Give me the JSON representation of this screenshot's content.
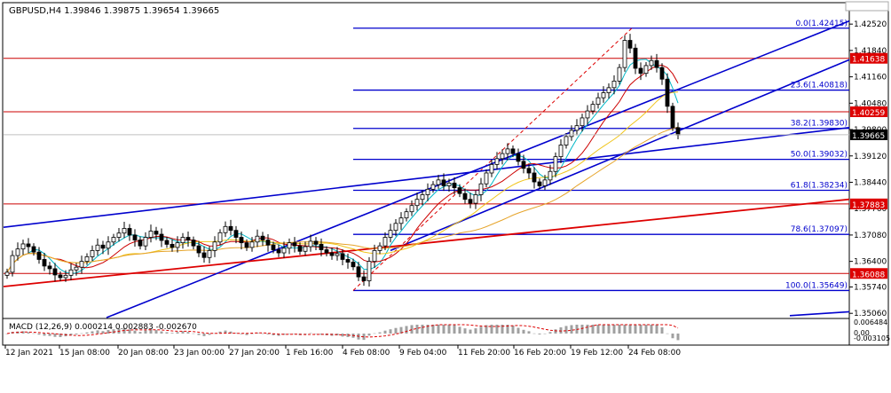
{
  "header": {
    "title": "GBPUSD,H4  1.39846 1.39875 1.39654 1.39665"
  },
  "macd_header": {
    "text": "MACD (12,26,9) 0.000214 0.002883 -0.002670"
  },
  "colors": {
    "background": "#ffffff",
    "candle": "#000000",
    "fib_line": "#0000cd",
    "fib_label": "#0000cd",
    "horizontal_level": "#cc0000",
    "trendline_blue": "#0000cd",
    "trendline_red": "#dd0000",
    "ma_fast": "#00b7c7",
    "ma_mid": "#cc0000",
    "ma_slow": "#f0c419",
    "ma_slowest": "#e6a42a",
    "fib_diagonal": "#dd0000",
    "price_tag_bg": "#dd0000",
    "current_tag_bg": "#000000",
    "tag_text": "#ffffff",
    "grid_text": "#000000",
    "macd_hist": "#a0a0a0",
    "macd_signal": "#dd0000"
  },
  "chart_data": {
    "type": "candlestick",
    "symbol": "GBPUSD",
    "timeframe": "H4",
    "ohlc_last": {
      "open": 1.39846,
      "high": 1.39875,
      "low": 1.39654,
      "close": 1.39665
    },
    "ylim": [
      1.3495,
      1.4305
    ],
    "y_ticks": [
      "1.42520",
      "1.41840",
      "1.41160",
      "1.40480",
      "1.39800",
      "1.39120",
      "1.38440",
      "1.37760",
      "1.37080",
      "1.36400",
      "1.35740",
      "1.35060"
    ],
    "x_labels": [
      "12 Jan 2021",
      "15 Jan 08:00",
      "20 Jan 08:00",
      "23 Jan 00:00",
      "27 Jan 20:00",
      "1 Feb 16:00",
      "4 Feb 08:00",
      "9 Feb 04:00",
      "11 Feb 20:00",
      "16 Feb 20:00",
      "19 Feb 12:00",
      "24 Feb 08:00"
    ],
    "fibonacci": [
      {
        "label": "0.0(1.42415)",
        "value": 1.42415
      },
      {
        "label": "23.6(1.40818)",
        "value": 1.40818
      },
      {
        "label": "38.2(1.39830)",
        "value": 1.3983
      },
      {
        "label": "50.0(1.39032)",
        "value": 1.39032
      },
      {
        "label": "61.8(1.38234)",
        "value": 1.38234
      },
      {
        "label": "78.6(1.37097)",
        "value": 1.37097
      },
      {
        "label": "100.0(1.35649)",
        "value": 1.35649
      }
    ],
    "horizontal_levels": [
      {
        "label": "1.41638",
        "value": 1.41638
      },
      {
        "label": "1.40259",
        "value": 1.40259
      },
      {
        "label": "1.37883",
        "value": 1.37883
      },
      {
        "label": "1.36088",
        "value": 1.36088
      }
    ],
    "current_price": {
      "label": "1.39665",
      "value": 1.39665
    },
    "close_series": [
      1.3612,
      1.3655,
      1.3672,
      1.3685,
      1.3678,
      1.3664,
      1.3645,
      1.3628,
      1.3621,
      1.3605,
      1.3598,
      1.3604,
      1.3618,
      1.3625,
      1.364,
      1.3652,
      1.3668,
      1.3682,
      1.3674,
      1.369,
      1.3702,
      1.3713,
      1.3725,
      1.3708,
      1.3695,
      1.368,
      1.3702,
      1.3718,
      1.371,
      1.3694,
      1.3684,
      1.3676,
      1.3688,
      1.3702,
      1.3695,
      1.368,
      1.3662,
      1.365,
      1.3668,
      1.369,
      1.3714,
      1.373,
      1.372,
      1.3702,
      1.3688,
      1.3676,
      1.369,
      1.3705,
      1.3695,
      1.3682,
      1.367,
      1.3662,
      1.3674,
      1.3688,
      1.368,
      1.3666,
      1.3678,
      1.3692,
      1.3684,
      1.367,
      1.3662,
      1.3655,
      1.366,
      1.3645,
      1.3638,
      1.3626,
      1.36,
      1.359,
      1.364,
      1.3668,
      1.368,
      1.3702,
      1.372,
      1.3738,
      1.3752,
      1.3768,
      1.3784,
      1.38,
      1.3812,
      1.3826,
      1.3838,
      1.385,
      1.3835,
      1.3842,
      1.383,
      1.3815,
      1.38,
      1.379,
      1.3812,
      1.384,
      1.3868,
      1.389,
      1.3905,
      1.3918,
      1.393,
      1.3918,
      1.3898,
      1.388,
      1.3868,
      1.3845,
      1.3835,
      1.385,
      1.3872,
      1.391,
      1.394,
      1.3962,
      1.3978,
      1.399,
      1.401,
      1.4028,
      1.4045,
      1.4062,
      1.4075,
      1.4088,
      1.4105,
      1.414,
      1.421,
      1.419,
      1.4138,
      1.4125,
      1.4145,
      1.4158,
      1.414,
      1.411,
      1.404,
      1.3985,
      1.3966
    ],
    "macd": {
      "name": "MACD (12,26,9)",
      "values": [
        "0.000214",
        "0.002883",
        "-0.002670"
      ],
      "y_ticks": [
        "0.006484",
        "0.00",
        "-0.003105"
      ]
    }
  }
}
